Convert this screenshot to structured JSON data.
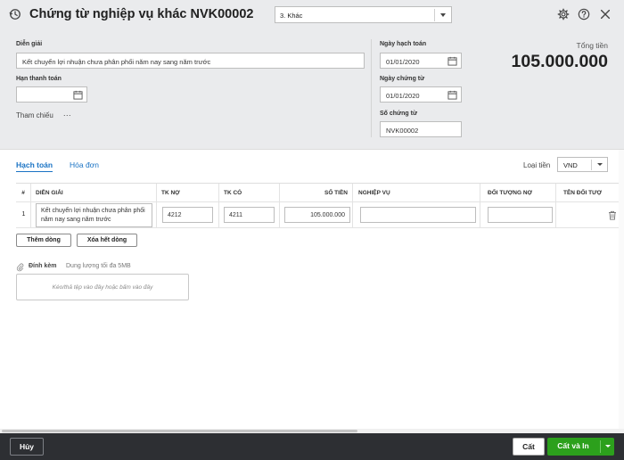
{
  "header": {
    "title": "Chứng từ nghiệp vụ khác NVK00002",
    "type_select_value": "3. Khác"
  },
  "form": {
    "description_label": "Diễn giải",
    "description_value": "Kết chuyển lợi nhuận chưa phân phối năm nay sang năm trước",
    "due_date_label": "Hạn thanh toán",
    "due_date_value": "",
    "reference_label": "Tham chiếu",
    "reference_more": "...",
    "posting_date_label": "Ngày hạch toán",
    "posting_date_value": "01/01/2020",
    "voucher_date_label": "Ngày chứng từ",
    "voucher_date_value": "01/01/2020",
    "voucher_no_label": "Số chứng từ",
    "voucher_no_value": "NVK00002",
    "total_label": "Tổng tiền",
    "total_value": "105.000.000"
  },
  "tabs": [
    {
      "label": "Hạch toán",
      "active": true
    },
    {
      "label": "Hóa đơn",
      "active": false
    }
  ],
  "currency": {
    "label": "Loại tiền",
    "value": "VND"
  },
  "grid": {
    "columns": [
      "#",
      "DIỄN GIẢI",
      "TK NỢ",
      "TK CÓ",
      "SỐ TIỀN",
      "NGHIỆP VỤ",
      "ĐỐI TƯỢNG NỢ",
      "TÊN ĐỐI TƯỢ"
    ],
    "rows": [
      {
        "index": "1",
        "description": "Kết chuyển lợi nhuận chưa phân phối năm nay sang năm trước",
        "debit_account": "4212",
        "credit_account": "4211",
        "amount": "105.000.000",
        "operation": "",
        "debit_object": "",
        "object_name": ""
      }
    ]
  },
  "grid_buttons": {
    "add_row": "Thêm dòng",
    "clear_all": "Xóa hết dòng"
  },
  "attachment": {
    "label": "Đính kèm",
    "note": "Dung lượng tối đa 5MB",
    "drop_hint": "Kéo/thả tệp vào đây hoặc bấm vào đây"
  },
  "footer": {
    "cancel": "Hủy",
    "save": "Cất",
    "save_print": "Cất và In"
  },
  "colors": {
    "accent_blue": "#1a73c4",
    "save_green": "#2ca01c",
    "footer_bg": "#2d2f33",
    "header_bg": "#eaebed"
  },
  "icons": [
    "history-icon",
    "settings-icon",
    "help-icon",
    "close-icon",
    "calendar-icon",
    "trash-icon",
    "paperclip-icon",
    "chevron-down-icon"
  ]
}
